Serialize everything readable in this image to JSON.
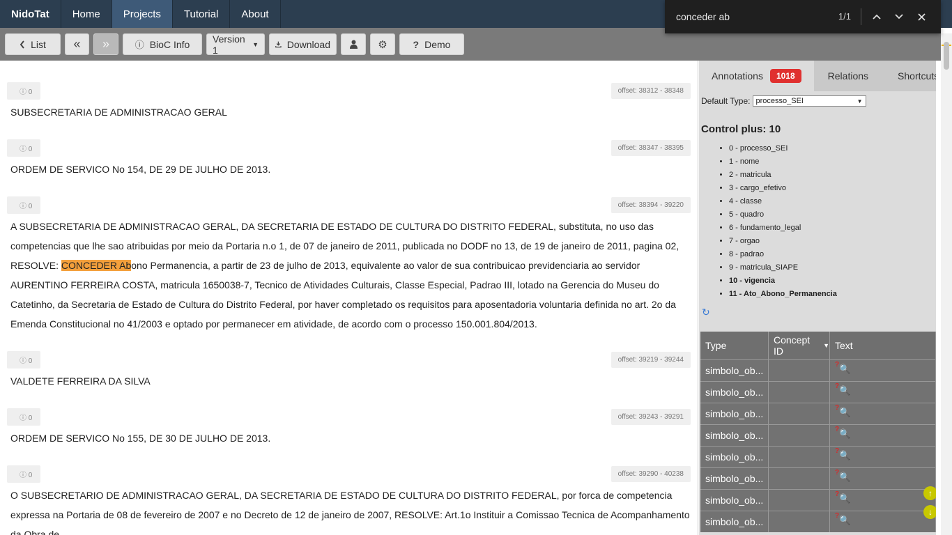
{
  "navbar": {
    "brand": "NidoTat",
    "items": [
      {
        "label": "Home",
        "active": false
      },
      {
        "label": "Projects",
        "active": true
      },
      {
        "label": "Tutorial",
        "active": false
      },
      {
        "label": "About",
        "active": false
      }
    ]
  },
  "findbar": {
    "query": "conceder ab",
    "count": "1/1"
  },
  "toolbar": {
    "list_label": "List",
    "prev_label": "«",
    "next_label": "»",
    "bioc_label": "BioC Info",
    "version_label": "Version 1",
    "download_label": "Download",
    "demo_label": "Demo"
  },
  "passages": [
    {
      "info": "0",
      "offset": "offset: 38312 - 38348",
      "text": "SUBSECRETARIA DE ADMINISTRACAO GERAL"
    },
    {
      "info": "0",
      "offset": "offset: 38347 - 38395",
      "text": "ORDEM DE SERVICO No 154, DE 29 DE JULHO DE 2013."
    },
    {
      "info": "0",
      "offset": "offset: 38394 - 39220",
      "text_before": "A SUBSECRETARIA DE ADMINISTRACAO GERAL, DA SECRETARIA DE ESTADO DE CULTURA DO DISTRITO FEDERAL, substituta, no uso das competencias que lhe sao atribuidas por meio da Portaria n.o 1, de 07 de janeiro de 2011, publicada no DODF no 13, de 19 de janeiro de 2011, pagina 02, RESOLVE: ",
      "highlight": "CONCEDER Ab",
      "text_after": "ono Permanencia, a partir de 23 de julho de 2013, equivalente ao valor de sua contribuicao previdenciaria ao servidor AURENTINO FERREIRA COSTA, matricula 1650038-7, Tecnico de Atividades Culturais, Classe Especial, Padrao III, lotado na Gerencia do Museu do Catetinho, da Secretaria de Estado de Cultura do Distrito Federal, por haver completado os requisitos para aposentadoria voluntaria definida no art. 2o da Emenda Constitucional no 41/2003 e optado por permanecer em atividade, de acordo com o processo 150.001.804/2013."
    },
    {
      "info": "0",
      "offset": "offset: 39219 - 39244",
      "text": "VALDETE FERREIRA DA SILVA"
    },
    {
      "info": "0",
      "offset": "offset: 39243 - 39291",
      "text": "ORDEM DE SERVICO No 155, DE 30 DE JULHO DE 2013."
    },
    {
      "info": "0",
      "offset": "offset: 39290 - 40238",
      "text": "O SUBSECRETARIO DE ADMINISTRACAO GERAL, DA SECRETARIA DE ESTADO DE CULTURA DO DISTRITO FEDERAL, por forca de competencia expressa na Portaria de 08 de fevereiro de 2007 e no Decreto de 12 de janeiro de 2007, RESOLVE: Art.1o Instituir a Comissao Tecnica de Acompanhamento da Obra de"
    }
  ],
  "panel": {
    "tabs": [
      {
        "label": "Annotations",
        "badge": "1018",
        "active": true
      },
      {
        "label": "Relations",
        "active": false
      },
      {
        "label": "Shortcuts",
        "active": false
      }
    ],
    "default_type_label": "Default Type:",
    "default_type_value": "processo_SEI",
    "control_title": "Control plus: 10",
    "legend": [
      {
        "label": "0 - processo_SEI",
        "bold": false
      },
      {
        "label": "1 - nome",
        "bold": false
      },
      {
        "label": "2 - matricula",
        "bold": false
      },
      {
        "label": "3 - cargo_efetivo",
        "bold": false
      },
      {
        "label": "4 - classe",
        "bold": false
      },
      {
        "label": "5 - quadro",
        "bold": false
      },
      {
        "label": "6 - fundamento_legal",
        "bold": false
      },
      {
        "label": "7 - orgao",
        "bold": false
      },
      {
        "label": "8 - padrao",
        "bold": false
      },
      {
        "label": "9 - matricula_SIAPE",
        "bold": false
      },
      {
        "label": "10 - vigencia",
        "bold": true
      },
      {
        "label": "11 - Ato_Abono_Permanencia",
        "bold": true
      }
    ],
    "table": {
      "headers": [
        "Type",
        "Concept ID",
        "Text"
      ],
      "rows": [
        "simbolo_ob...",
        "simbolo_ob...",
        "simbolo_ob...",
        "simbolo_ob...",
        "simbolo_ob...",
        "simbolo_ob...",
        "simbolo_ob...",
        "simbolo_ob..."
      ]
    }
  },
  "colors": {
    "navbar": "#2c3e50",
    "navbar_active": "#3e5a78",
    "toolbar": "#7a7a7a",
    "highlight": "#f4a03c",
    "badge": "#e0302f"
  }
}
